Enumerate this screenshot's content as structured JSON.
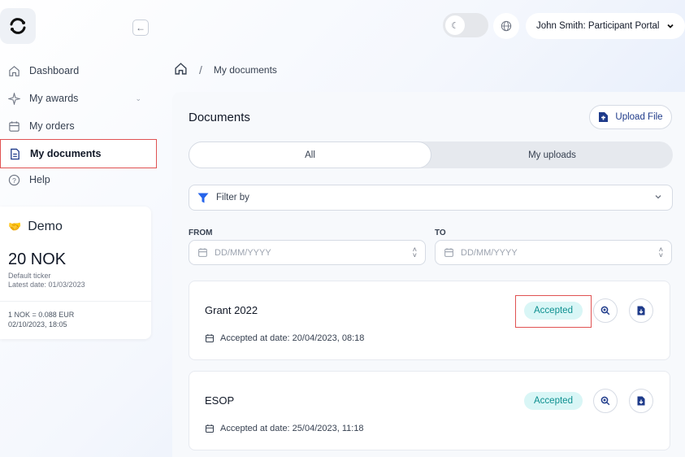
{
  "header": {
    "user_label": "John Smith: Participant Portal"
  },
  "sidebar": {
    "items": [
      {
        "label": "Dashboard"
      },
      {
        "label": "My awards"
      },
      {
        "label": "My orders"
      },
      {
        "label": "My documents"
      },
      {
        "label": "Help"
      }
    ],
    "card": {
      "title": "Demo",
      "amount": "20 NOK",
      "ticker_label": "Default ticker",
      "latest_date": "Latest date: 01/03/2023",
      "rate": "1 NOK = 0.088 EUR",
      "rate_time": "02/10/2023, 18:05"
    }
  },
  "breadcrumb": {
    "separator": "/",
    "current": "My documents"
  },
  "main": {
    "title": "Documents",
    "upload_label": "Upload File",
    "tabs": [
      {
        "label": "All",
        "active": true
      },
      {
        "label": "My uploads",
        "active": false
      }
    ],
    "filter": {
      "label": "Filter by"
    },
    "from": {
      "label": "FROM",
      "placeholder": "DD/MM/YYYY"
    },
    "to": {
      "label": "TO",
      "placeholder": "DD/MM/YYYY"
    },
    "documents": [
      {
        "name": "Grant 2022",
        "status": "Accepted",
        "accepted_at": "Accepted at date: 20/04/2023, 08:18"
      },
      {
        "name": "ESOP",
        "status": "Accepted",
        "accepted_at": "Accepted at date: 25/04/2023, 11:18"
      }
    ]
  },
  "colors": {
    "accent": "#1e3a8a",
    "filter_icon": "#2563eb",
    "badge_bg": "#d9f6f6",
    "badge_text": "#0c8f8f",
    "highlight": "#e05252"
  },
  "icons": {
    "logo": "logo-icon",
    "collapse": "arrow-left-icon",
    "theme": "moon-icon",
    "language": "globe-icon",
    "user_menu": "chevron-down-icon",
    "home": "home-icon",
    "upload": "upload-icon",
    "filter": "filter-icon",
    "calendar": "calendar-icon",
    "preview": "zoom-in-icon",
    "download": "download-icon"
  }
}
